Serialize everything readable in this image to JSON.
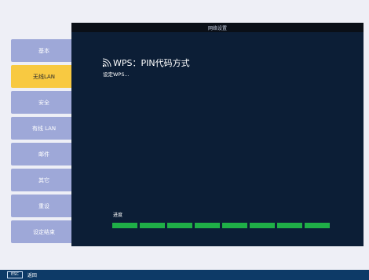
{
  "window": {
    "title": "网络设置"
  },
  "sidebar": {
    "items": [
      {
        "label": "基本",
        "active": false
      },
      {
        "label": "无线LAN",
        "active": true
      },
      {
        "label": "安全",
        "active": false
      },
      {
        "label": "有线 LAN",
        "active": false
      },
      {
        "label": "邮件",
        "active": false
      },
      {
        "label": "其它",
        "active": false
      },
      {
        "label": "重设",
        "active": false
      },
      {
        "label": "设定结束",
        "active": false
      }
    ]
  },
  "main": {
    "title_icon": "wifi-icon",
    "title": "WPS：PIN代码方式",
    "status": "设定WPS...",
    "progress_label": "进度",
    "progress_segments_filled": 8,
    "progress_segments_total": 8
  },
  "footer": {
    "key": "ESC",
    "label": "返回"
  },
  "colors": {
    "background": "#eeeff6",
    "panel": "#0c1e36",
    "sidebar_button": "#9ea8d8",
    "sidebar_active": "#f8c941",
    "progress": "#1faf47",
    "footer": "#0d3a67"
  }
}
